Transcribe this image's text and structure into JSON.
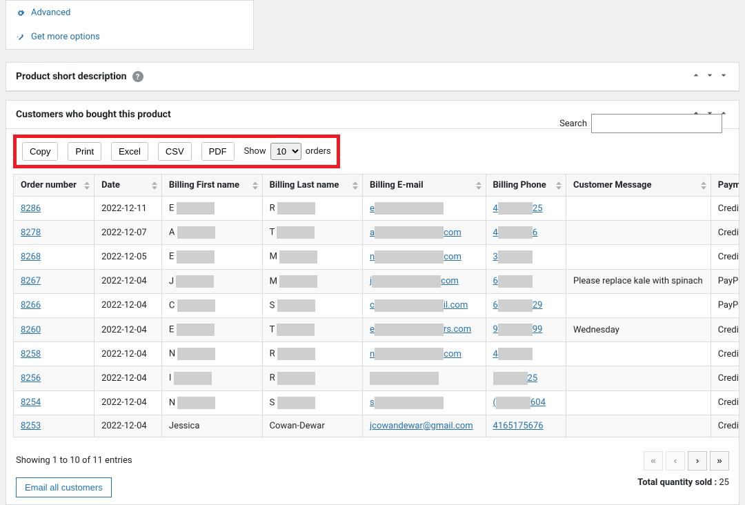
{
  "sidebar": {
    "advanced_label": "Advanced",
    "more_options_label": "Get more options"
  },
  "panels": {
    "short_desc_title": "Product short description",
    "customers_title": "Customers who bought this product"
  },
  "toolbar": {
    "copy": "Copy",
    "print": "Print",
    "excel": "Excel",
    "csv": "CSV",
    "pdf": "PDF",
    "show": "Show",
    "orders": "orders",
    "page_size": "10",
    "search_label": "Search"
  },
  "columns": [
    "Order number",
    "Date",
    "Billing First name",
    "Billing Last name",
    "Billing E-mail",
    "Billing Phone",
    "Customer Message",
    "Payment"
  ],
  "rows": [
    {
      "order": "8286",
      "date": "2022-12-11",
      "fn_initial": "E",
      "ln_initial": "R",
      "email_prefix": "e",
      "email_suffix": "",
      "phone_prefix": "4",
      "phone_suffix": "25",
      "msg": "",
      "pay": "Credit Car"
    },
    {
      "order": "8278",
      "date": "2022-12-07",
      "fn_initial": "A",
      "ln_initial": "T",
      "email_prefix": "a",
      "email_suffix": "com",
      "phone_prefix": "4",
      "phone_suffix": "6",
      "msg": "",
      "pay": "Credit Car"
    },
    {
      "order": "8268",
      "date": "2022-12-05",
      "fn_initial": "E",
      "ln_initial": "M",
      "email_prefix": "n",
      "email_suffix": "com",
      "phone_prefix": "3",
      "phone_suffix": "",
      "msg": "",
      "pay": "Credit Car"
    },
    {
      "order": "8267",
      "date": "2022-12-04",
      "fn_initial": "J",
      "ln_initial": "M",
      "email_prefix": "j",
      "email_suffix": "com",
      "phone_prefix": "6",
      "phone_suffix": "",
      "msg": "Please replace kale with spinach",
      "pay": "PayPal"
    },
    {
      "order": "8266",
      "date": "2022-12-04",
      "fn_initial": "C",
      "ln_initial": "S",
      "email_prefix": "c",
      "email_suffix": "il.com",
      "phone_prefix": "6",
      "phone_suffix": "29",
      "msg": "",
      "pay": "PayPal"
    },
    {
      "order": "8260",
      "date": "2022-12-04",
      "fn_initial": "E",
      "ln_initial": "T",
      "email_prefix": "e",
      "email_suffix": "rs.com",
      "phone_prefix": "9",
      "phone_suffix": "99",
      "msg": "Wednesday",
      "pay": "Credit Car"
    },
    {
      "order": "8258",
      "date": "2022-12-04",
      "fn_initial": "N",
      "ln_initial": "R",
      "email_prefix": "n",
      "email_suffix": "com",
      "phone_prefix": "4",
      "phone_suffix": "",
      "msg": "",
      "pay": "Credit Car"
    },
    {
      "order": "8256",
      "date": "2022-12-04",
      "fn_initial": "I",
      "ln_initial": "R",
      "email_prefix": "",
      "email_suffix": "",
      "phone_prefix": "",
      "phone_suffix": "25",
      "msg": "",
      "pay": "Credit Car"
    },
    {
      "order": "8254",
      "date": "2022-12-04",
      "fn_initial": "N",
      "ln_initial": "S",
      "email_prefix": "s",
      "email_suffix": "",
      "phone_prefix": "(",
      "phone_suffix": "604",
      "msg": "",
      "pay": "Credit Car"
    },
    {
      "order": "8253",
      "date": "2022-12-04",
      "fn_initial": "Jessica",
      "ln_initial": "Cowan-Dewar",
      "email_prefix": "jcowandewar@gmail.com",
      "email_suffix": "",
      "phone_prefix": "4165175676",
      "phone_suffix": "",
      "msg": "",
      "pay": "Credit Car"
    }
  ],
  "footer": {
    "showing": "Showing 1 to 10 of 11 entries",
    "email_all": "Email all customers",
    "total_sold_label": "Total quantity sold :",
    "total_sold_value": "25"
  }
}
